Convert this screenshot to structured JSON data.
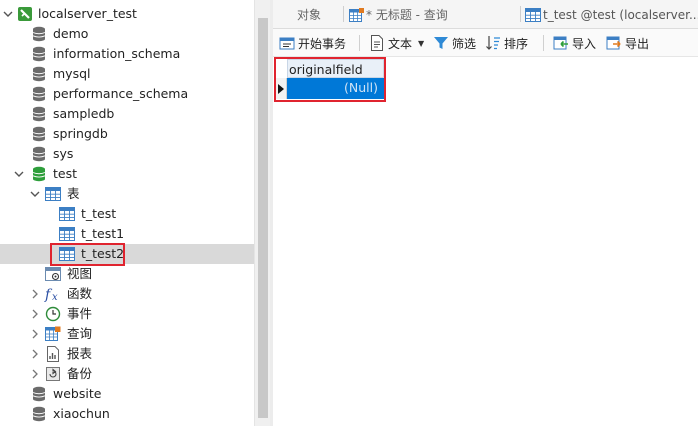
{
  "sidebar": {
    "connection": "localserver_test",
    "databases": {
      "demo": "demo",
      "information_schema": "information_schema",
      "mysql": "mysql",
      "performance_schema": "performance_schema",
      "sampledb": "sampledb",
      "springdb": "springdb",
      "sys": "sys",
      "test": "test",
      "website": "website",
      "xiaochun": "xiaochun"
    },
    "test_children": {
      "tables": "表",
      "views": "视图",
      "functions": "函数",
      "events": "事件",
      "queries": "查询",
      "reports": "报表",
      "backups": "备份"
    },
    "tables": [
      "t_test",
      "t_test1",
      "t_test2"
    ],
    "selected_table": "t_test2"
  },
  "tabs": {
    "objects": "对象",
    "untitled_query": "* 无标题 - 查询",
    "table_tab": "t_test @test (localserver..."
  },
  "toolbar": {
    "begin_transaction": "开始事务",
    "text": "文本",
    "filter": "筛选",
    "sort": "排序",
    "import": "导入",
    "export": "导出"
  },
  "grid": {
    "column_header": "originalfield",
    "cell_value": "(Null)"
  },
  "colors": {
    "selection_blue": "#0078d7",
    "highlight_red": "#e0242f",
    "db_icon_gray": "#6b6b6b",
    "db_icon_green": "#2e9e3b",
    "table_icon_blue": "#3c7fc4"
  }
}
